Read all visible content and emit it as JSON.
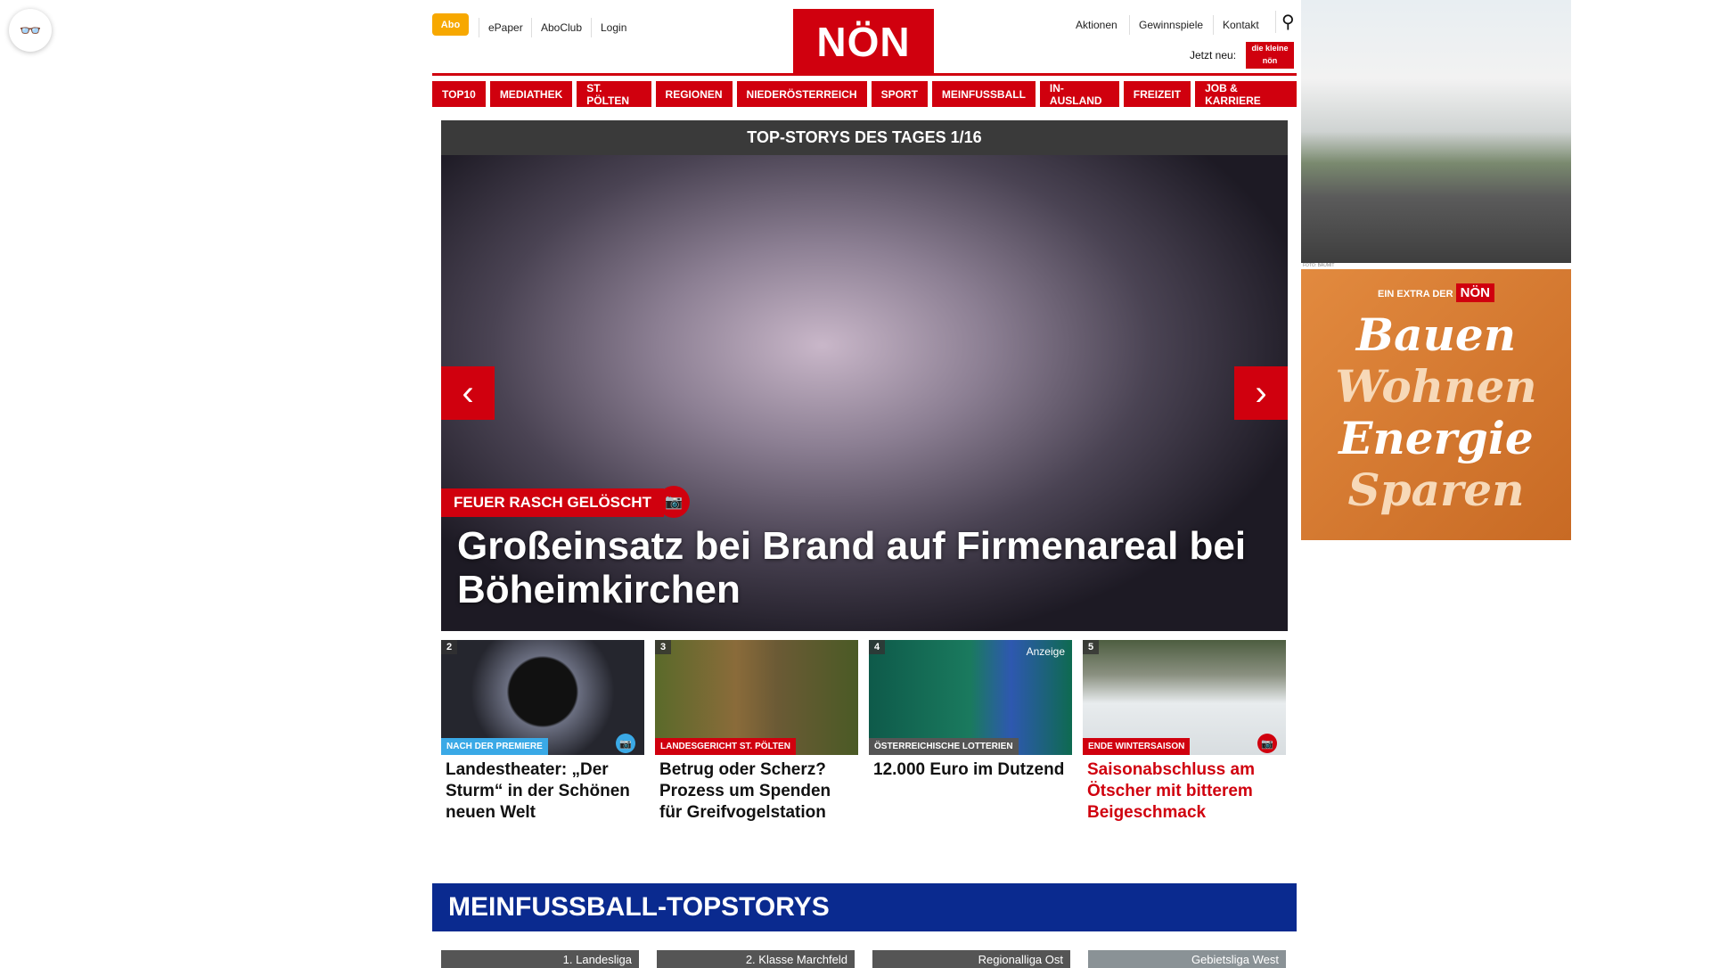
{
  "reader_icon": "glasses-icon",
  "header": {
    "abo": "Abo",
    "links_left": [
      "ePaper",
      "AboClub",
      "Login"
    ],
    "logo": "NÖN",
    "links_right": [
      "Aktionen",
      "Gewinnspiele",
      "Kontakt"
    ],
    "jetzt_neu": "Jetzt neu:",
    "kids_logo": "die kleine nön"
  },
  "nav": [
    "TOP10",
    "MEDIATHEK",
    "ST. PÖLTEN",
    "REGIONEN",
    "NIEDERÖSTERREICH",
    "SPORT",
    "MEINFUSSBALL",
    "IN-AUSLAND",
    "FREIZEIT",
    "JOB & KARRIERE"
  ],
  "slider": {
    "title": "TOP-STORYS DES TAGES 1/16",
    "kicker": "FEUER RASCH GELÖSCHT",
    "headline": "Großeinsatz bei Brand auf Firmenareal bei Böheimkirchen"
  },
  "cards": [
    {
      "num": "2",
      "label": "NACH DER PREMIERE",
      "label_color": "#3aa9e6",
      "title": "Landestheater: „Der Sturm“ in der Schönen neuen Welt",
      "title_color": "#111111"
    },
    {
      "num": "3",
      "label": "LANDESGERICHT ST. PÖLTEN",
      "label_color": "#d0000e",
      "title": "Betrug oder Scherz? Prozess um Spenden für Greifvogelstation",
      "title_color": "#111111"
    },
    {
      "num": "4",
      "label": "ÖSTERREICHISCHE LOTTERIEN",
      "label_color": "#555555",
      "ad": "Anzeige",
      "title": "12.000 Euro im Dutzend",
      "title_color": "#111111"
    },
    {
      "num": "5",
      "label": "ENDE WINTERSAISON",
      "label_color": "#d0000e",
      "title": "Saisonabschluss am Ötscher mit bitterem Beigeschmack",
      "title_color": "#d0000e"
    }
  ],
  "football": {
    "title": "MEINFUSSBALL-TOPSTORYS",
    "items": [
      "1. Landesliga",
      "2. Klasse Marchfeld",
      "Regionalliga Ost",
      "Gebietsliga West"
    ]
  },
  "ad": {
    "credit": "FOTO: BAUMIT",
    "extra": "EIN EXTRA DER",
    "logo": "NÖN",
    "lines": [
      "Bauen",
      "Wohnen",
      "Energie",
      "Sparen"
    ]
  }
}
